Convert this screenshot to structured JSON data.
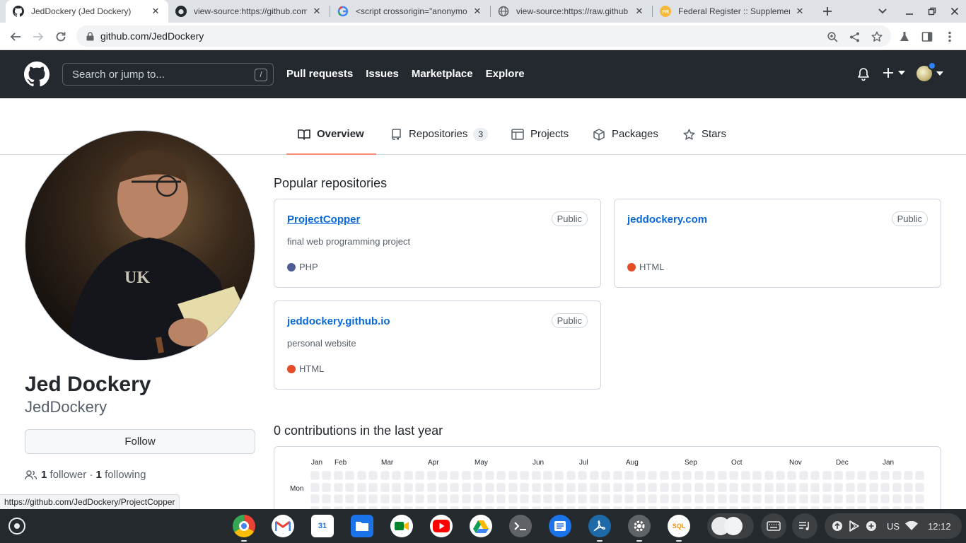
{
  "browser": {
    "tabs": [
      {
        "title": "JedDockery (Jed Dockery)",
        "favicon": "github-icon",
        "active": true
      },
      {
        "title": "view-source:https://github.com",
        "favicon": "github-icon",
        "active": false
      },
      {
        "title": "<script crossorigin=\"anonymous\"",
        "favicon": "google-icon",
        "active": false
      },
      {
        "title": "view-source:https://raw.github",
        "favicon": "globe-icon",
        "active": false
      },
      {
        "title": "Federal Register :: Supplement",
        "favicon": "federal-register-icon",
        "active": false
      }
    ],
    "url": "github.com/JedDockery",
    "status_url": "https://github.com/JedDockery/ProjectCopper"
  },
  "github": {
    "search_placeholder": "Search or jump to...",
    "search_shortcut": "/",
    "nav": [
      "Pull requests",
      "Issues",
      "Marketplace",
      "Explore"
    ]
  },
  "profile_tabs": [
    {
      "label": "Overview",
      "icon": "book-icon"
    },
    {
      "label": "Repositories",
      "icon": "repo-icon",
      "count": "3"
    },
    {
      "label": "Projects",
      "icon": "table-icon"
    },
    {
      "label": "Packages",
      "icon": "package-icon"
    },
    {
      "label": "Stars",
      "icon": "star-icon"
    }
  ],
  "profile": {
    "name": "Jed Dockery",
    "username": "JedDockery",
    "follow_label": "Follow",
    "followers_count": "1",
    "followers_label": "follower",
    "following_count": "1",
    "following_label": "following",
    "separator": "·"
  },
  "popular": {
    "title": "Popular repositories",
    "repos": [
      {
        "name": "ProjectCopper",
        "visibility": "Public",
        "description": "final web programming project",
        "language": "PHP",
        "language_color": "#4F5D95"
      },
      {
        "name": "jeddockery.com",
        "visibility": "Public",
        "description": "",
        "language": "HTML",
        "language_color": "#e34c26"
      },
      {
        "name": "jeddockery.github.io",
        "visibility": "Public",
        "description": "personal website",
        "language": "HTML",
        "language_color": "#e34c26"
      }
    ]
  },
  "contributions": {
    "title": "0 contributions in the last year",
    "months": [
      "Jan",
      "Feb",
      "Mar",
      "Apr",
      "May",
      "Jun",
      "Jul",
      "Aug",
      "Sep",
      "Oct",
      "Nov",
      "Dec",
      "Jan"
    ],
    "day_label": "Mon",
    "cell_color": "#ebedf0"
  },
  "shelf": {
    "apps": [
      "chrome-icon",
      "gmail-icon",
      "calendar-icon",
      "files-icon",
      "meet-icon",
      "youtube-icon",
      "drive-icon",
      "terminal-icon",
      "docs-icon",
      "acrobat-icon",
      "settings-icon",
      "sql-icon"
    ],
    "calendar_day": "31",
    "sql_label": "SQL",
    "locale": "US",
    "time": "12:12"
  },
  "colors": {
    "gh_header": "#24292f",
    "link": "#0969da",
    "tab_underline": "#fd8c73"
  }
}
